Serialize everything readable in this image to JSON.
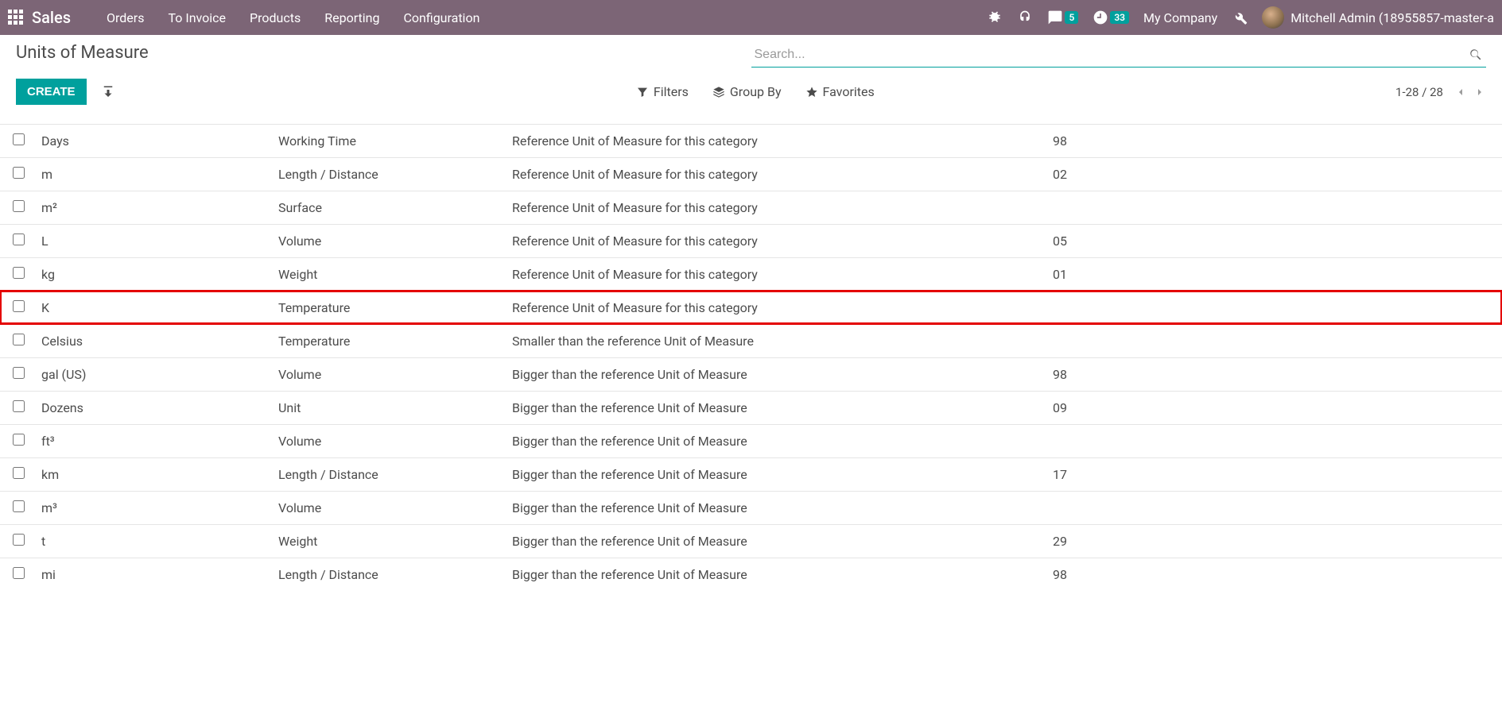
{
  "navbar": {
    "app_name": "Sales",
    "menu": [
      "Orders",
      "To Invoice",
      "Products",
      "Reporting",
      "Configuration"
    ],
    "messages_badge": "5",
    "activities_badge": "33",
    "company": "My Company",
    "user": "Mitchell Admin (18955857-master-a"
  },
  "control_panel": {
    "title": "Units of Measure",
    "create_label": "CREATE",
    "search_placeholder": "Search...",
    "filters_label": "Filters",
    "groupby_label": "Group By",
    "favorites_label": "Favorites",
    "pager": "1-28 / 28"
  },
  "rows": [
    {
      "uom": "Days",
      "category": "Working Time",
      "type": "Reference Unit of Measure for this category",
      "ratio": "98",
      "highlight": false
    },
    {
      "uom": "m",
      "category": "Length / Distance",
      "type": "Reference Unit of Measure for this category",
      "ratio": "02",
      "highlight": false
    },
    {
      "uom": "m²",
      "category": "Surface",
      "type": "Reference Unit of Measure for this category",
      "ratio": "",
      "highlight": false
    },
    {
      "uom": "L",
      "category": "Volume",
      "type": "Reference Unit of Measure for this category",
      "ratio": "05",
      "highlight": false
    },
    {
      "uom": "kg",
      "category": "Weight",
      "type": "Reference Unit of Measure for this category",
      "ratio": "01",
      "highlight": false
    },
    {
      "uom": "K",
      "category": "Temperature",
      "type": "Reference Unit of Measure for this category",
      "ratio": "",
      "highlight": true
    },
    {
      "uom": "Celsius",
      "category": "Temperature",
      "type": "Smaller than the reference Unit of Measure",
      "ratio": "",
      "highlight": false
    },
    {
      "uom": "gal (US)",
      "category": "Volume",
      "type": "Bigger than the reference Unit of Measure",
      "ratio": "98",
      "highlight": false
    },
    {
      "uom": "Dozens",
      "category": "Unit",
      "type": "Bigger than the reference Unit of Measure",
      "ratio": "09",
      "highlight": false
    },
    {
      "uom": "ft³",
      "category": "Volume",
      "type": "Bigger than the reference Unit of Measure",
      "ratio": "",
      "highlight": false
    },
    {
      "uom": "km",
      "category": "Length / Distance",
      "type": "Bigger than the reference Unit of Measure",
      "ratio": "17",
      "highlight": false
    },
    {
      "uom": "m³",
      "category": "Volume",
      "type": "Bigger than the reference Unit of Measure",
      "ratio": "",
      "highlight": false
    },
    {
      "uom": "t",
      "category": "Weight",
      "type": "Bigger than the reference Unit of Measure",
      "ratio": "29",
      "highlight": false
    },
    {
      "uom": "mi",
      "category": "Length / Distance",
      "type": "Bigger than the reference Unit of Measure",
      "ratio": "98",
      "highlight": false
    }
  ]
}
